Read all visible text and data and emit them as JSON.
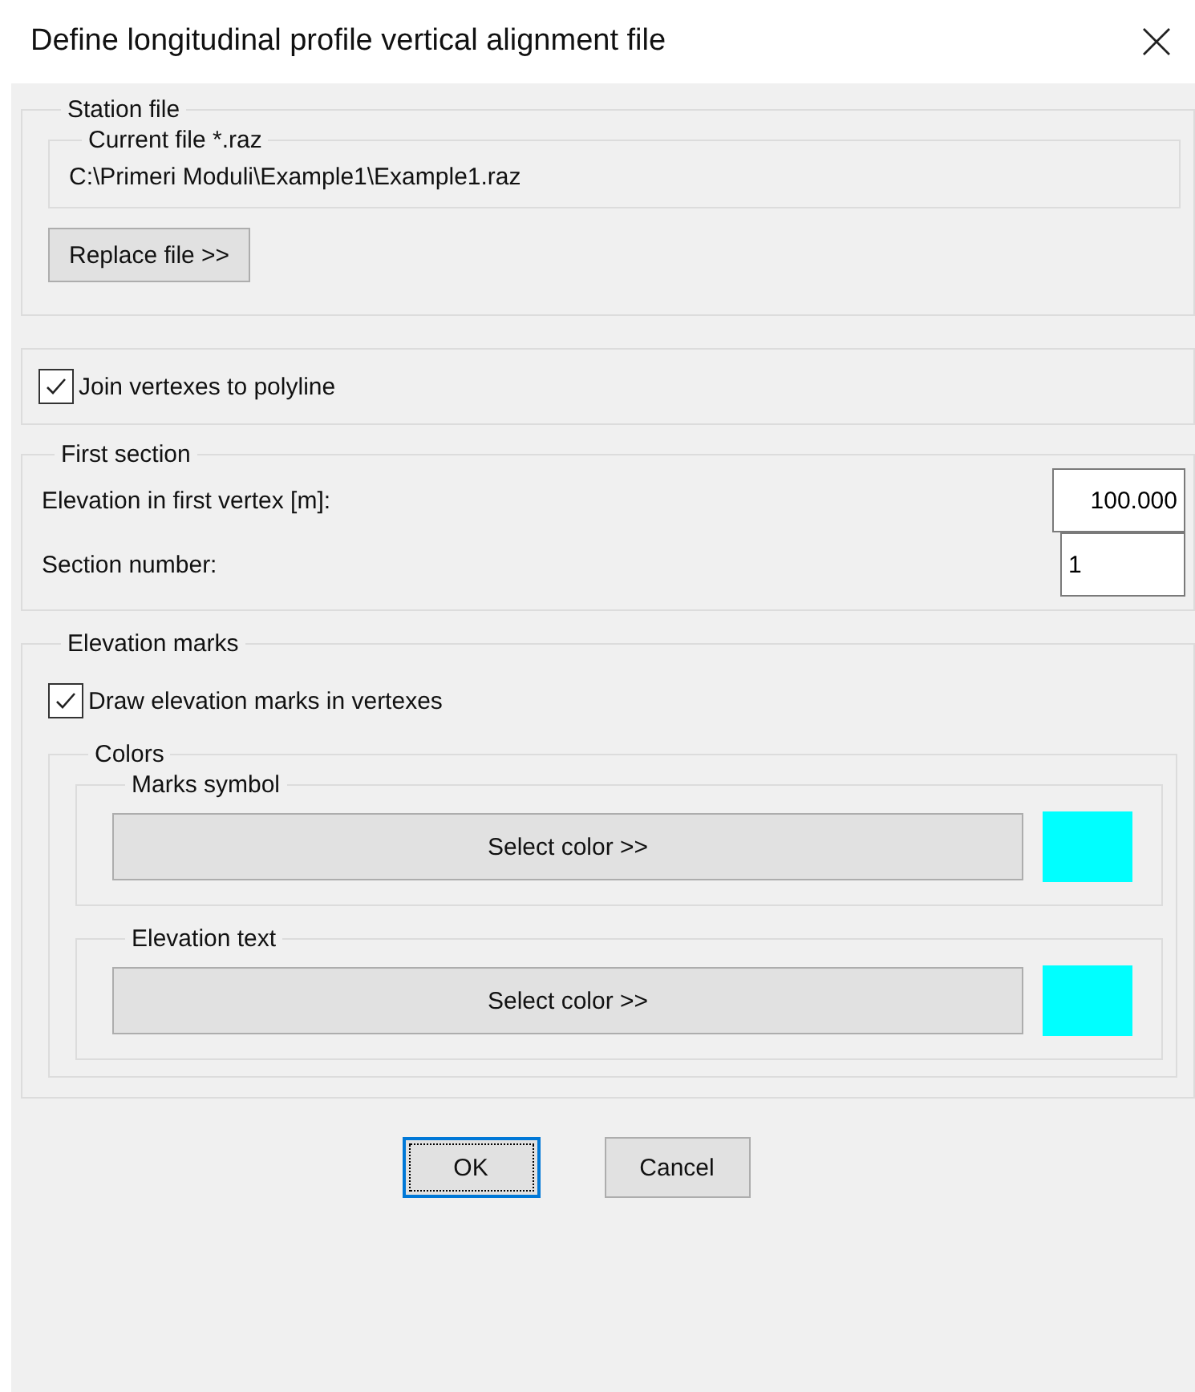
{
  "window": {
    "title": "Define longitudinal profile vertical alignment file"
  },
  "station_file": {
    "title": "Station file",
    "current_file": {
      "title": "Current file *.raz",
      "path": "C:\\Primeri Moduli\\Example1\\Example1.raz"
    },
    "replace_button": "Replace file >>"
  },
  "join": {
    "label": "Join vertexes to polyline",
    "checked": true
  },
  "first_section": {
    "title": "First section",
    "fields": [
      {
        "label": "Elevation in first vertex [m]:",
        "value": "100.000"
      },
      {
        "label": "Section number:",
        "value": "1"
      }
    ]
  },
  "elevation_marks": {
    "title": "Elevation marks",
    "draw": {
      "label": "Draw elevation marks in vertexes",
      "checked": true
    },
    "colors": {
      "title": "Colors",
      "items": [
        {
          "title": "Marks symbol",
          "button": "Select color >>",
          "color": "#00ffff"
        },
        {
          "title": "Elevation text",
          "button": "Select color >>",
          "color": "#00ffff"
        }
      ]
    }
  },
  "buttons": [
    {
      "label": "OK",
      "focused": true
    },
    {
      "label": "Cancel",
      "focused": false
    }
  ]
}
